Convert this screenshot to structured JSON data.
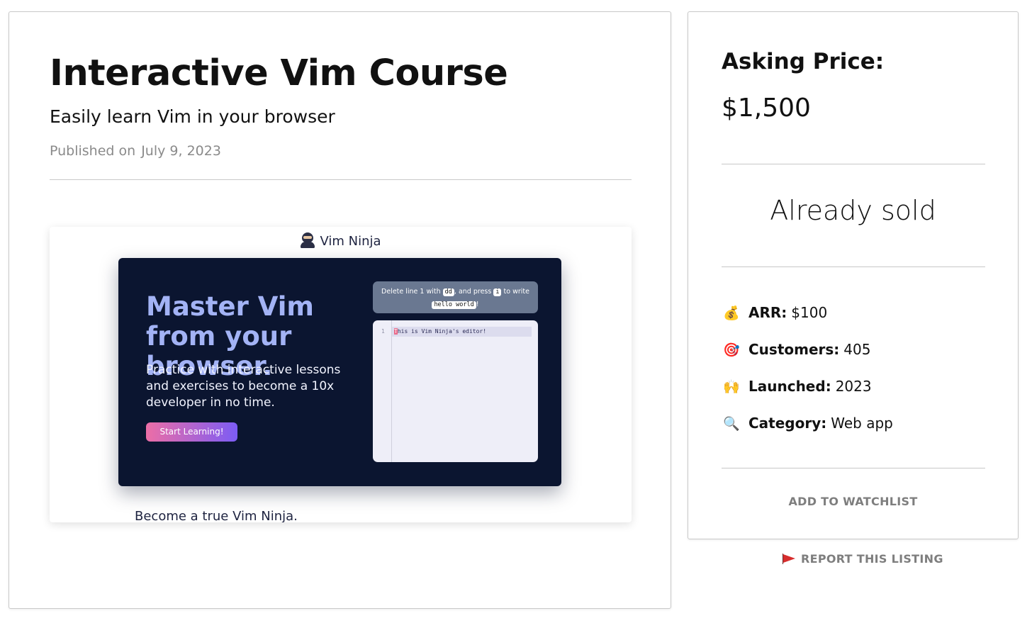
{
  "listing": {
    "title": "Interactive Vim Course",
    "subtitle": "Easily learn Vim in your browser",
    "published_label": "Published on",
    "published_date": "July 9, 2023"
  },
  "preview": {
    "brand": "Vim Ninja",
    "brand_icon": "ninja-icon",
    "hero_title": "Master Vim from your browser.",
    "hero_description": "Practice with interactive lessons and exercises to become a 10x developer in no time.",
    "cta_label": "Start Learning!",
    "tip": {
      "part1": "Delete line 1 with",
      "key1": "dd",
      "part2": ", and press",
      "key2": "i",
      "part3": "to write",
      "key3": "hello world",
      "part4": "!"
    },
    "editor": {
      "line_number": "1",
      "cursor_char": "T",
      "line_text": "his is Vim Ninja's editor!"
    },
    "footer_text": "Become a true Vim Ninja."
  },
  "sidebar": {
    "asking_label": "Asking Price:",
    "asking_price": "$1,500",
    "status": "Already sold",
    "stats": [
      {
        "icon": "money-bag-icon",
        "emoji": "💰",
        "label": "ARR:",
        "value": "$100"
      },
      {
        "icon": "target-icon",
        "emoji": "🎯",
        "label": "Customers:",
        "value": "405"
      },
      {
        "icon": "raised-hands-icon",
        "emoji": "🙌",
        "label": "Launched:",
        "value": "2023"
      },
      {
        "icon": "magnifier-icon",
        "emoji": "🔍",
        "label": "Category:",
        "value": "Web app"
      }
    ],
    "watchlist_label": "ADD TO WATCHLIST"
  },
  "report": {
    "icon": "red-flag-icon",
    "label": "REPORT THIS LISTING"
  },
  "colors": {
    "hero_bg": "#0b1530",
    "hero_title": "#a3b3f5",
    "cta_gradient_start": "#ec6ea6",
    "cta_gradient_end": "#7c5cf5",
    "muted_text": "#7e7e7e",
    "flag": "#d72d2d"
  }
}
